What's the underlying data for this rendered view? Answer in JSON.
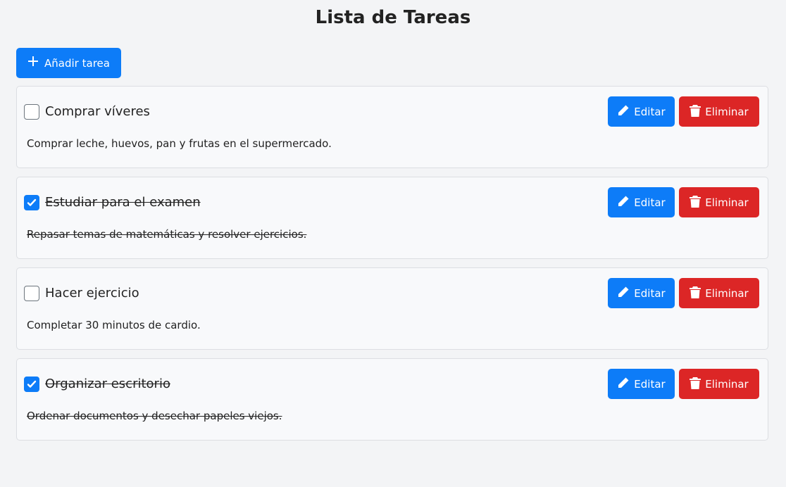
{
  "header": {
    "title": "Lista de Tareas"
  },
  "toolbar": {
    "add_label": "Añadir tarea",
    "add_icon": "plus-icon"
  },
  "tasks": [
    {
      "title": "Comprar víveres",
      "description": "Comprar leche, huevos, pan y frutas en el supermercado.",
      "completed": false,
      "edit_label": "Editar",
      "delete_label": "Eliminar"
    },
    {
      "title": "Estudiar para el examen",
      "description": "Repasar temas de matemáticas y resolver ejercicios.",
      "completed": true,
      "edit_label": "Editar",
      "delete_label": "Eliminar"
    },
    {
      "title": "Hacer ejercicio",
      "description": "Completar 30 minutos de cardio.",
      "completed": false,
      "edit_label": "Editar",
      "delete_label": "Eliminar"
    },
    {
      "title": "Organizar escritorio",
      "description": "Ordenar documentos y desechar papeles viejos.",
      "completed": true,
      "edit_label": "Editar",
      "delete_label": "Eliminar"
    }
  ],
  "colors": {
    "primary": "#0d7cf8",
    "danger": "#dc2626",
    "background": "#f3f4f6",
    "card": "#f8f9fb"
  }
}
